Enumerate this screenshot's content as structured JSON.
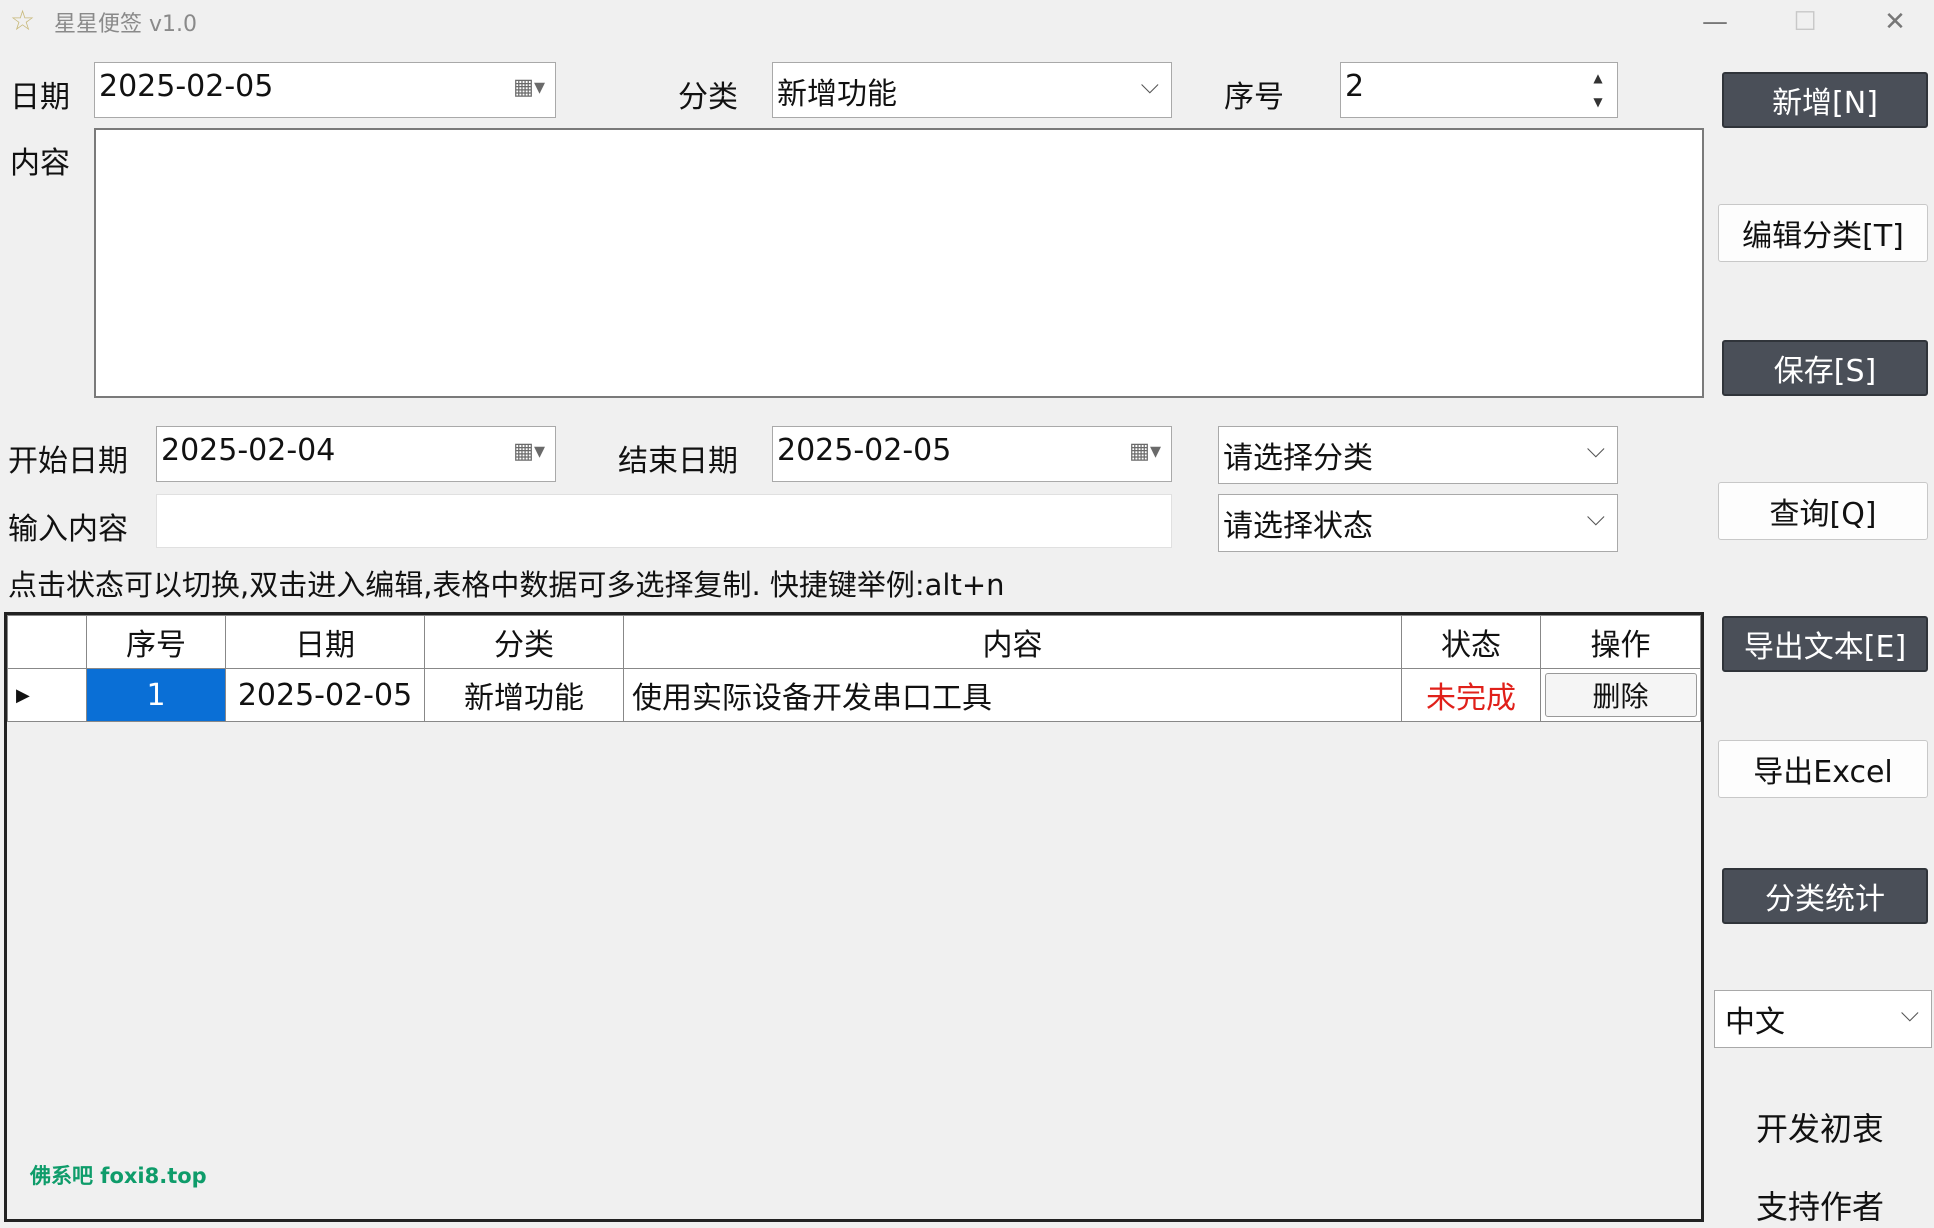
{
  "window": {
    "title": "星星便签 v1.0",
    "app_icon": "star-icon",
    "minimize": "—",
    "maximize": "☐",
    "close": "✕"
  },
  "form": {
    "date_label": "日期",
    "date_value": "2025-02-05",
    "category_label": "分类",
    "category_value": "新增功能",
    "seq_label": "序号",
    "seq_value": "2",
    "content_label": "内容",
    "content_value": ""
  },
  "query": {
    "start_label": "开始日期",
    "start_value": "2025-02-04",
    "end_label": "结束日期",
    "end_value": "2025-02-05",
    "category_placeholder": "请选择分类",
    "input_label": "输入内容",
    "input_value": "",
    "status_placeholder": "请选择状态",
    "hint": "点击状态可以切换,双击进入编辑,表格中数据可多选择复制.  快捷键举例:alt+n"
  },
  "table": {
    "headers": [
      "序号",
      "日期",
      "分类",
      "内容",
      "状态",
      "操作"
    ],
    "rows": [
      {
        "seq": "1",
        "date": "2025-02-05",
        "category": "新增功能",
        "content": "使用实际设备开发串口工具",
        "status": "未完成",
        "action": "删除"
      }
    ]
  },
  "sidebar": {
    "add": "新增[N]",
    "edit_category": "编辑分类[T]",
    "save": "保存[S]",
    "query": "查询[Q]",
    "export_text": "导出文本[E]",
    "export_excel": "导出Excel",
    "category_stats": "分类统计",
    "language": "中文",
    "dev_note": "开发初衷",
    "support": "支持作者"
  },
  "watermark": "佛系吧  foxi8.top",
  "colors": {
    "accent_dark_button": "#4a4f58",
    "selection_blue": "#0a6fd6",
    "status_red": "#e0201a",
    "watermark_green": "#0e9c6a"
  }
}
